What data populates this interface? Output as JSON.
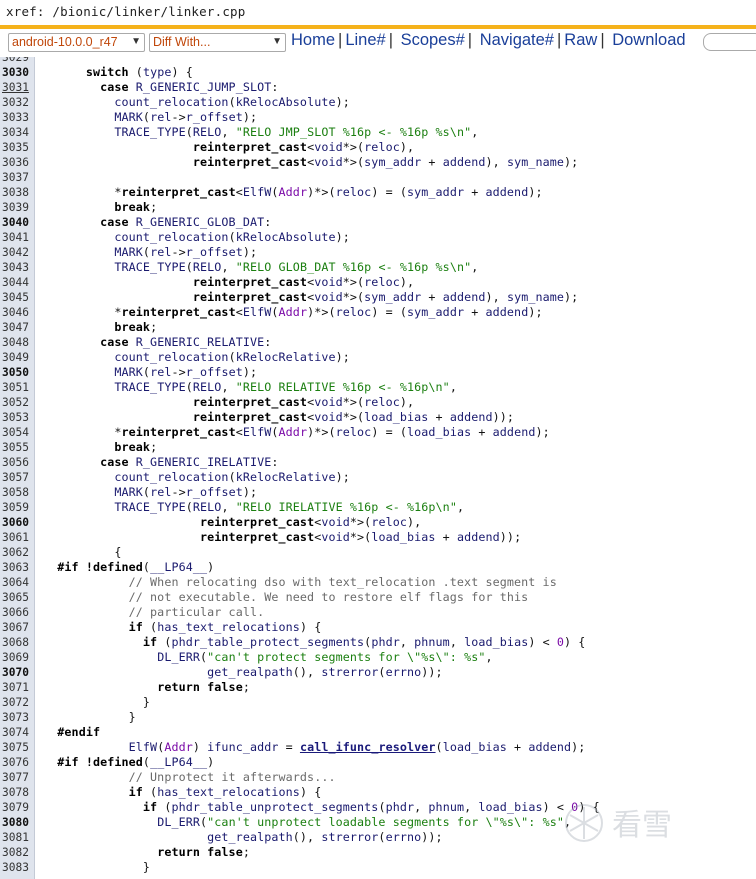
{
  "xref_path": "xref: /bionic/linker/linker.cpp",
  "colors": {
    "accent_bar": "#f5b21b",
    "link": "#1a3f99",
    "select_text": "#c0470a",
    "gutter": "#dfe4ed"
  },
  "toolbar": {
    "version_select": "android-10.0.0_r47",
    "diff_select": "Diff With...",
    "nav": [
      "Home",
      "Line#",
      "Scopes#",
      "Navigate#",
      "Raw",
      "Download"
    ],
    "search_placeholder": ""
  },
  "watermark_text": "看雪",
  "lines": [
    {
      "n": "3029",
      "t": ""
    },
    {
      "n": "3030",
      "t": "      <k>switch</k> (<i>type</i>) {",
      "b": true
    },
    {
      "n": "3031",
      "t": "        <k>case</k> <i>R_GENERIC_JUMP_SLOT</i>:",
      "u": true
    },
    {
      "n": "3032",
      "t": "          <i>count_relocation</i>(<i>kRelocAbsolute</i>);"
    },
    {
      "n": "3033",
      "t": "          <i>MARK</i>(<i>rel</i>-><i>r_offset</i>);"
    },
    {
      "n": "3034",
      "t": "          <i>TRACE_TYPE</i>(<i>RELO</i>, <s>\"RELO JMP_SLOT %16p <- %16p %s\\n\"</s>,"
    },
    {
      "n": "3035",
      "t": "                     <k>reinterpret_cast</k><<i>void</i>*>(<i>reloc</i>),"
    },
    {
      "n": "3036",
      "t": "                     <k>reinterpret_cast</k><<i>void</i>*>(<i>sym_addr</i> + <i>addend</i>), <i>sym_name</i>);"
    },
    {
      "n": "3037",
      "t": ""
    },
    {
      "n": "3038",
      "t": "          *<k>reinterpret_cast</k><<i>ElfW</i>(<n>Addr</n>)*>(<i>reloc</i>) = (<i>sym_addr</i> + <i>addend</i>);"
    },
    {
      "n": "3039",
      "t": "          <k>break</k>;"
    },
    {
      "n": "3040",
      "t": "        <k>case</k> <i>R_GENERIC_GLOB_DAT</i>:",
      "b": true
    },
    {
      "n": "3041",
      "t": "          <i>count_relocation</i>(<i>kRelocAbsolute</i>);"
    },
    {
      "n": "3042",
      "t": "          <i>MARK</i>(<i>rel</i>-><i>r_offset</i>);"
    },
    {
      "n": "3043",
      "t": "          <i>TRACE_TYPE</i>(<i>RELO</i>, <s>\"RELO GLOB_DAT %16p <- %16p %s\\n\"</s>,"
    },
    {
      "n": "3044",
      "t": "                     <k>reinterpret_cast</k><<i>void</i>*>(<i>reloc</i>),"
    },
    {
      "n": "3045",
      "t": "                     <k>reinterpret_cast</k><<i>void</i>*>(<i>sym_addr</i> + <i>addend</i>), <i>sym_name</i>);"
    },
    {
      "n": "3046",
      "t": "          *<k>reinterpret_cast</k><<i>ElfW</i>(<n>Addr</n>)*>(<i>reloc</i>) = (<i>sym_addr</i> + <i>addend</i>);"
    },
    {
      "n": "3047",
      "t": "          <k>break</k>;"
    },
    {
      "n": "3048",
      "t": "        <k>case</k> <i>R_GENERIC_RELATIVE</i>:"
    },
    {
      "n": "3049",
      "t": "          <i>count_relocation</i>(<i>kRelocRelative</i>);"
    },
    {
      "n": "3050",
      "t": "          <i>MARK</i>(<i>rel</i>-><i>r_offset</i>);",
      "b": true
    },
    {
      "n": "3051",
      "t": "          <i>TRACE_TYPE</i>(<i>RELO</i>, <s>\"RELO RELATIVE %16p <- %16p\\n\"</s>,"
    },
    {
      "n": "3052",
      "t": "                     <k>reinterpret_cast</k><<i>void</i>*>(<i>reloc</i>),"
    },
    {
      "n": "3053",
      "t": "                     <k>reinterpret_cast</k><<i>void</i>*>(<i>load_bias</i> + <i>addend</i>));"
    },
    {
      "n": "3054",
      "t": "          *<k>reinterpret_cast</k><<i>ElfW</i>(<n>Addr</n>)*>(<i>reloc</i>) = (<i>load_bias</i> + <i>addend</i>);"
    },
    {
      "n": "3055",
      "t": "          <k>break</k>;"
    },
    {
      "n": "3056",
      "t": "        <k>case</k> <i>R_GENERIC_IRELATIVE</i>:"
    },
    {
      "n": "3057",
      "t": "          <i>count_relocation</i>(<i>kRelocRelative</i>);"
    },
    {
      "n": "3058",
      "t": "          <i>MARK</i>(<i>rel</i>-><i>r_offset</i>);"
    },
    {
      "n": "3059",
      "t": "          <i>TRACE_TYPE</i>(<i>RELO</i>, <s>\"RELO IRELATIVE %16p <- %16p\\n\"</s>,"
    },
    {
      "n": "3060",
      "t": "                      <k>reinterpret_cast</k><<i>void</i>*>(<i>reloc</i>),",
      "b": true
    },
    {
      "n": "3061",
      "t": "                      <k>reinterpret_cast</k><<i>void</i>*>(<i>load_bias</i> + <i>addend</i>));"
    },
    {
      "n": "3062",
      "t": "          {"
    },
    {
      "n": "3063",
      "t": "  <k>#if !defined</k>(<i>__LP64__</i>)"
    },
    {
      "n": "3064",
      "t": "            <c>// When relocating dso with text_relocation .text segment is</c>"
    },
    {
      "n": "3065",
      "t": "            <c>// not executable. We need to restore elf flags for this</c>"
    },
    {
      "n": "3066",
      "t": "            <c>// particular call.</c>"
    },
    {
      "n": "3067",
      "t": "            <k>if</k> (<i>has_text_relocations</i>) {"
    },
    {
      "n": "3068",
      "t": "              <k>if</k> (<i>phdr_table_protect_segments</i>(<i>phdr</i>, <i>phnum</i>, <i>load_bias</i>) < <n>0</n>) {"
    },
    {
      "n": "3069",
      "t": "                <i>DL_ERR</i>(<s>\"can't protect segments for \\\"%s\\\": %s\"</s>,"
    },
    {
      "n": "3070",
      "t": "                       <i>get_realpath</i>(), <i>strerror</i>(<i>errno</i>));",
      "b": true
    },
    {
      "n": "3071",
      "t": "                <k>return false</k>;"
    },
    {
      "n": "3072",
      "t": "              }"
    },
    {
      "n": "3073",
      "t": "            }"
    },
    {
      "n": "3074",
      "t": "  <k>#endif</k>"
    },
    {
      "n": "3075",
      "t": "            <i>ElfW</i>(<n>Addr</n>) <i>ifunc_addr</i> = <f>call_ifunc_resolver</f>(<i>load_bias</i> + <i>addend</i>);"
    },
    {
      "n": "3076",
      "t": "  <k>#if !defined</k>(<i>__LP64__</i>)"
    },
    {
      "n": "3077",
      "t": "            <c>// Unprotect it afterwards...</c>"
    },
    {
      "n": "3078",
      "t": "            <k>if</k> (<i>has_text_relocations</i>) {"
    },
    {
      "n": "3079",
      "t": "              <k>if</k> (<i>phdr_table_unprotect_segments</i>(<i>phdr</i>, <i>phnum</i>, <i>load_bias</i>) < <n>0</n>) {"
    },
    {
      "n": "3080",
      "t": "                <i>DL_ERR</i>(<s>\"can't unprotect loadable segments for \\\"%s\\\": %s\"</s>,",
      "b": true
    },
    {
      "n": "3081",
      "t": "                       <i>get_realpath</i>(), <i>strerror</i>(<i>errno</i>));"
    },
    {
      "n": "3082",
      "t": "                <k>return false</k>;"
    },
    {
      "n": "3083",
      "t": "              }"
    }
  ]
}
